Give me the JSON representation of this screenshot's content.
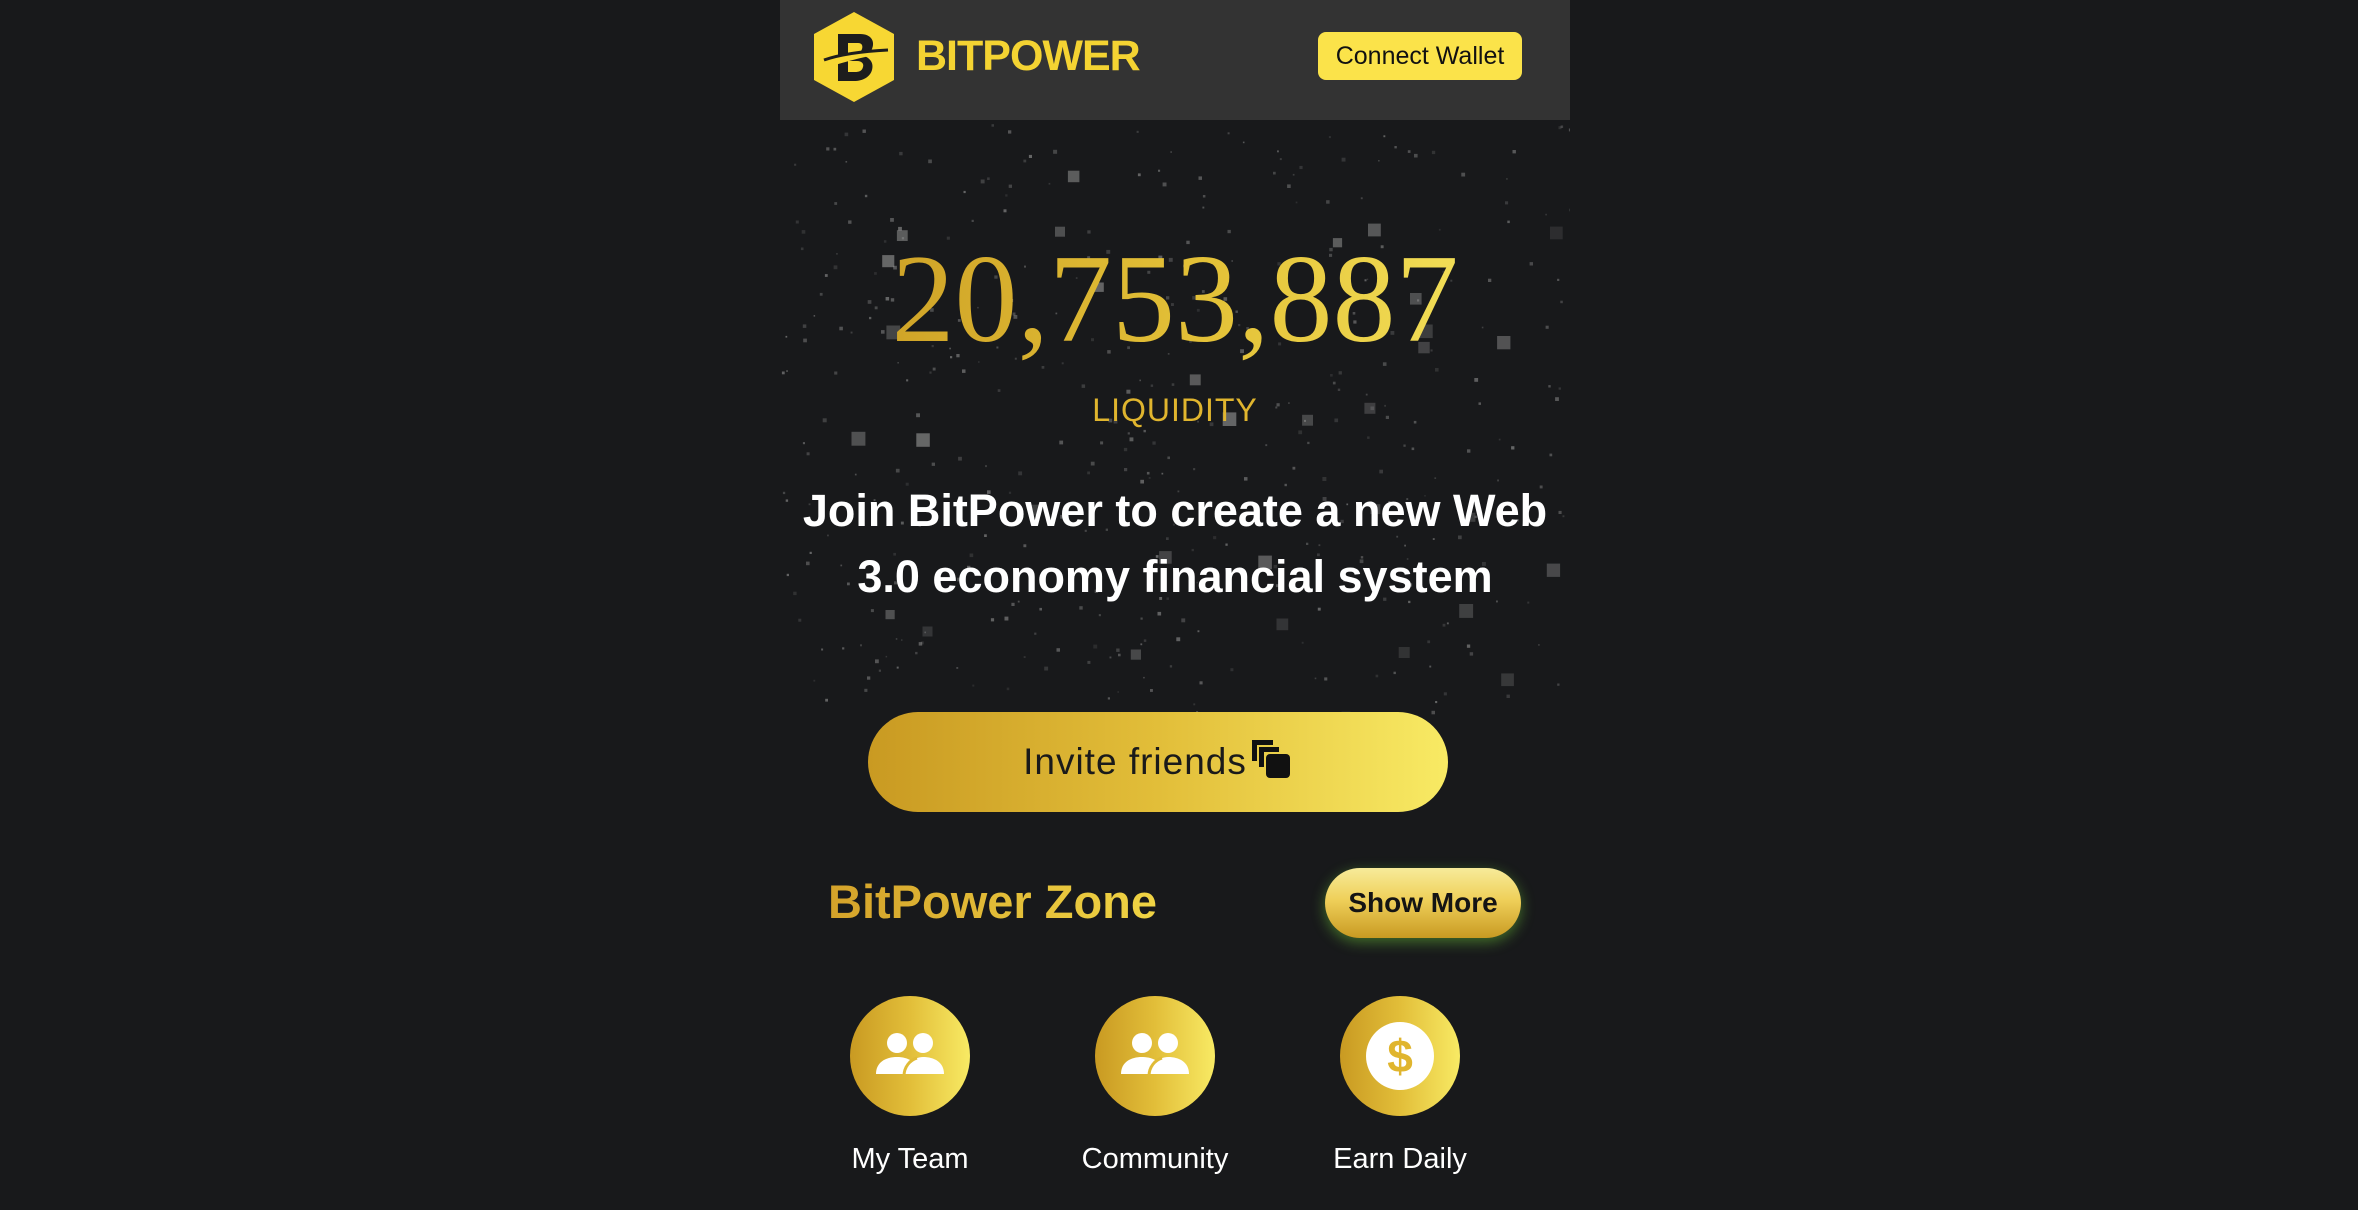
{
  "header": {
    "brand": "BITPOWER",
    "connect_label": "Connect Wallet"
  },
  "hero": {
    "value": "20,753,887",
    "label": "LIQUIDITY",
    "headline_line1": "Join BitPower to create a new Web",
    "headline_line2": "3.0 economy financial system"
  },
  "invite": {
    "label": "Invite friends",
    "icon": "copy-icon"
  },
  "zone": {
    "title": "BitPower Zone",
    "show_more_label": "Show More",
    "items": [
      {
        "label": "My Team",
        "icon": "team-icon"
      },
      {
        "label": "Community",
        "icon": "community-icon"
      },
      {
        "label": "Earn Daily",
        "icon": "dollar-icon"
      }
    ]
  },
  "colors": {
    "background": "#18191b",
    "header": "#333333",
    "accent_yellow": "#fbe34a",
    "gold_dark": "#c99a22",
    "gold_light": "#f8ea64"
  }
}
